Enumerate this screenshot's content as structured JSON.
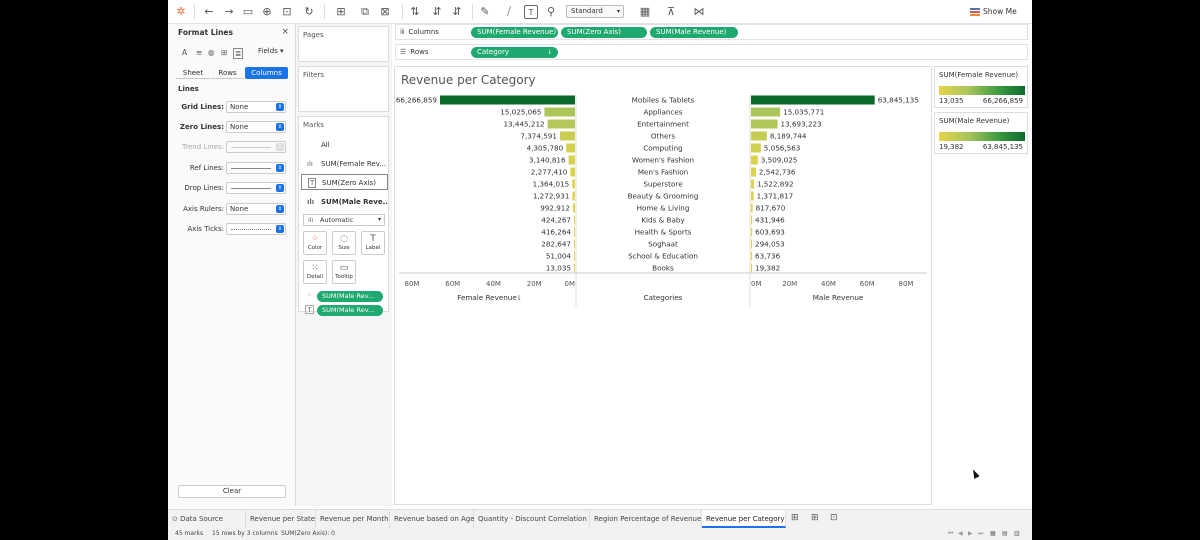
{
  "toolbar": {
    "fit_select": "Standard",
    "show_me": "Show Me"
  },
  "format_panel": {
    "title": "Format Lines",
    "close": "×",
    "fields_label": "Fields",
    "tabs": [
      "Sheet",
      "Rows",
      "Columns"
    ],
    "active_tab": "Columns",
    "section": "Lines",
    "rows": [
      {
        "label": "Grid Lines:",
        "value": "None",
        "style": "bold"
      },
      {
        "label": "Zero Lines:",
        "value": "None",
        "style": "bold"
      },
      {
        "label": "Trend Lines:",
        "value": "",
        "style": "dim"
      },
      {
        "label": "Ref Lines:",
        "value": "",
        "style": "normal"
      },
      {
        "label": "Drop Lines:",
        "value": "",
        "style": "normal"
      },
      {
        "label": "Axis Rulers:",
        "value": "None",
        "style": "normal"
      },
      {
        "label": "Axis Ticks:",
        "value": "",
        "style": "normal"
      }
    ],
    "clear": "Clear"
  },
  "cards": {
    "pages": "Pages",
    "filters": "Filters",
    "marks": "Marks",
    "mark_rows": [
      "All",
      "SUM(Female Rev...",
      "SUM(Zero Axis)",
      "SUM(Male Reve..."
    ],
    "mark_type": "Automatic",
    "buttons": [
      "Color",
      "Size",
      "Label",
      "Detail",
      "Tooltip"
    ],
    "pills": [
      "SUM(Male Rev...",
      "SUM(Male Rev..."
    ]
  },
  "shelves": {
    "columns_label": "Columns",
    "rows_label": "Rows",
    "column_pills": [
      "SUM(Female Revenue)",
      "SUM(Zero Axis)",
      "SUM(Male Revenue)"
    ],
    "row_pills": [
      "Category"
    ]
  },
  "view": {
    "title": "Revenue per Category"
  },
  "chart_data": {
    "type": "bar",
    "title": "Revenue per Category",
    "categories": [
      "Mobiles & Tablets",
      "Appliances",
      "Entertainment",
      "Others",
      "Computing",
      "Women's Fashion",
      "Men's Fashion",
      "Superstore",
      "Beauty & Grooming",
      "Home & Living",
      "Kids & Baby",
      "Health & Sports",
      "Soghaat",
      "School & Education",
      "Books"
    ],
    "series": [
      {
        "name": "Female Revenue",
        "values": [
          66266859,
          15025065,
          13445212,
          7374591,
          4305780,
          3140816,
          2277410,
          1364015,
          1272931,
          992912,
          424267,
          416264,
          282647,
          51004,
          13035
        ],
        "labels": [
          "66,266,859",
          "15,025,065",
          "13,445,212",
          "7,374,591",
          "4,305,780",
          "3,140,816",
          "2,277,410",
          "1,364,015",
          "1,272,931",
          "992,912",
          "424,267",
          "416,264",
          "282,647",
          "51,004",
          "13,035"
        ]
      },
      {
        "name": "Male Revenue",
        "values": [
          63845135,
          15035771,
          13693223,
          8189744,
          5056563,
          3509025,
          2542736,
          1522892,
          1371817,
          817670,
          431946,
          603693,
          294053,
          63736,
          19382
        ],
        "labels": [
          "63,845,135",
          "15,035,771",
          "13,693,223",
          "8,189,744",
          "5,056,563",
          "3,509,025",
          "2,542,736",
          "1,522,892",
          "1,371,817",
          "817,670",
          "431,946",
          "603,693",
          "294,053",
          "63,736",
          "19,382"
        ]
      }
    ],
    "center_header": "Categories",
    "female_axis": {
      "label": "Female Revenue",
      "ticks": [
        "80M",
        "60M",
        "40M",
        "20M",
        "0M"
      ],
      "reversed": true,
      "range": [
        0,
        80000000
      ]
    },
    "male_axis": {
      "label": "Male Revenue",
      "ticks": [
        "0M",
        "20M",
        "40M",
        "60M",
        "80M"
      ],
      "range": [
        0,
        80000000
      ]
    },
    "legend_female": {
      "title": "SUM(Female Revenue)",
      "min": "13,035",
      "max": "66,266,859"
    },
    "legend_male": {
      "title": "SUM(Male Revenue)",
      "min": "19,382",
      "max": "63,845,135"
    },
    "colors": {
      "low": "#e5d44a",
      "high": "#0b6a2b"
    }
  },
  "sheet_tabs": [
    "Data Source",
    "Revenue per State",
    "Revenue per Month",
    "Revenue based on Age",
    "Quantity - Discount Correlation",
    "Region Percentage of Revenue",
    "Revenue per Category"
  ],
  "active_sheet": "Revenue per Category",
  "status": {
    "marks": "45 marks",
    "rows": "15 rows by 3 columns",
    "sum": "SUM(Zero Axis): 0"
  }
}
